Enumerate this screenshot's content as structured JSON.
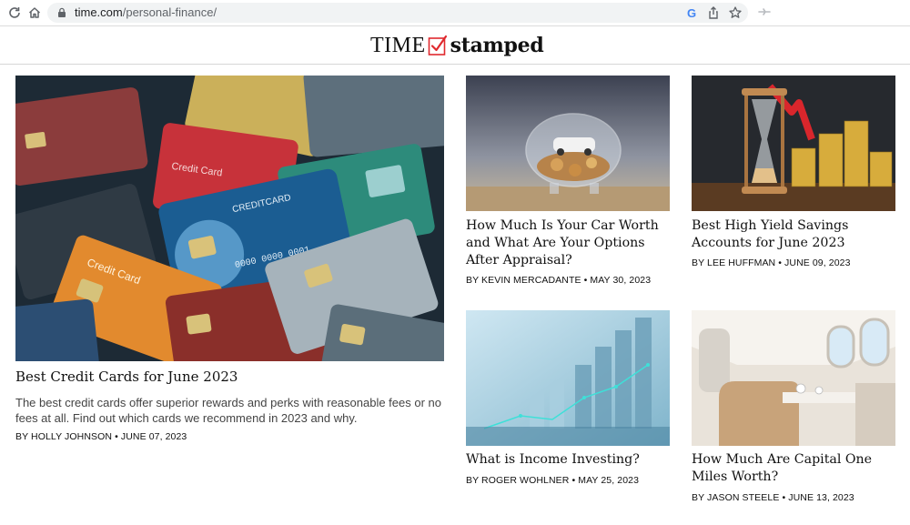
{
  "browser": {
    "url_host": "time.com",
    "url_path": "/personal-finance/",
    "icons": [
      "reload-icon",
      "home-icon",
      "lock-icon",
      "google-icon",
      "share-icon",
      "star-icon",
      "extension-icon"
    ]
  },
  "site": {
    "logo_time": "TIME",
    "logo_stamped": "stamped",
    "accent_color": "#e0292e"
  },
  "articles": {
    "hero": {
      "title": "Best Credit Cards for June 2023",
      "dek": "The best credit cards offer superior rewards and perks with reasonable fees or no fees at all. Find out which cards we recommend in 2023 and why.",
      "byline": "BY HOLLY JOHNSON • JUNE 07, 2023",
      "image": "pile-of-credit-cards"
    },
    "car": {
      "title": "How Much Is Your Car Worth and What Are Your Options After Appraisal?",
      "byline": "BY KEVIN MERCADANTE • MAY 30, 2023",
      "image": "glass-piggy-bank-with-toy-car"
    },
    "savings": {
      "title": "Best High Yield Savings Accounts for June 2023",
      "byline": "BY LEE HUFFMAN • JUNE 09, 2023",
      "image": "hourglass-with-coin-stacks"
    },
    "income": {
      "title": "What is Income Investing?",
      "byline": "BY ROGER WOHLNER • MAY 25, 2023",
      "image": "coin-stacks-with-growth-chart"
    },
    "miles": {
      "title": "How Much Are Capital One Miles Worth?",
      "byline": "BY JASON STEELE • JUNE 13, 2023",
      "image": "airplane-business-class-cabin"
    }
  }
}
